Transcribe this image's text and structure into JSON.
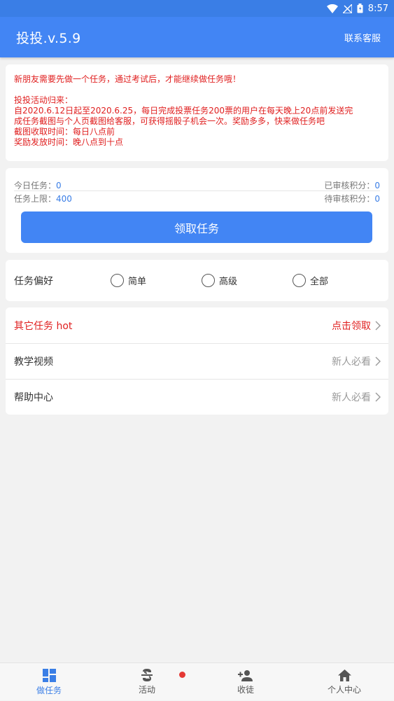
{
  "status": {
    "time": "8:57"
  },
  "header": {
    "title": "投投.v.5.9",
    "contact": "联系客服"
  },
  "notice": {
    "line1": "新朋友需要先做一个任务，通过考试后，才能继续做任务哦！",
    "line2": "投投活动归来：",
    "line3": "自2020.6.12日起至2020.6.25，每日完成投票任务200票的用户在每天晚上20点前发送完",
    "line4": "成任务截图与个人页截图给客服，可获得摇骰子机会一次。奖励多多，快来做任务吧",
    "line5": "截图收取时间：每日八点前",
    "line6": "奖励发放时间：晚八点到十点"
  },
  "stats": {
    "today_label": "今日任务：",
    "today_value": "0",
    "approved_label": "已审核积分：",
    "approved_value": "0",
    "limit_label": "任务上限：",
    "limit_value": "400",
    "pending_label": "待审核积分：",
    "pending_value": "0",
    "claim_button": "领取任务"
  },
  "preference": {
    "label": "任务偏好",
    "options": [
      "简单",
      "高级",
      "全部"
    ]
  },
  "list": [
    {
      "label": "其它任务 hot",
      "right": "点击领取"
    },
    {
      "label": "教学视频",
      "right": "新人必看"
    },
    {
      "label": "帮助中心",
      "right": "新人必看"
    }
  ],
  "nav": {
    "tasks": "做任务",
    "activity": "活动",
    "disciples": "收徒",
    "profile": "个人中心"
  },
  "colors": {
    "primary": "#4285f4",
    "alert": "#e02020",
    "badge": "#e53935"
  }
}
